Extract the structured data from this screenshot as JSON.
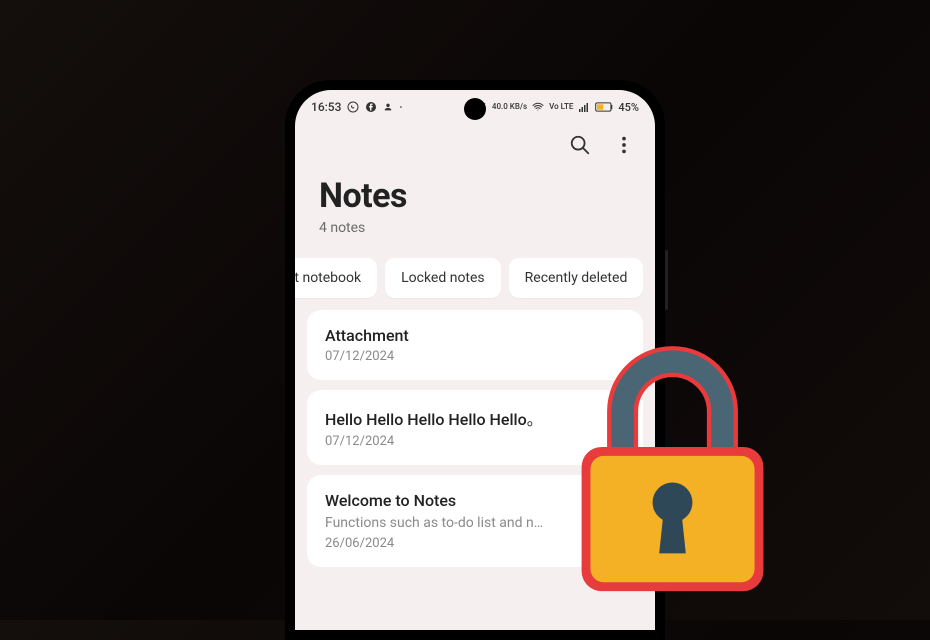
{
  "statusBar": {
    "time": "16:53",
    "dataRate": "40.0 KB/s",
    "lte": "Vo LTE",
    "battery": "45%"
  },
  "header": {
    "title": "Notes",
    "subtitle": "4 notes"
  },
  "chips": [
    {
      "label": "lt notebook"
    },
    {
      "label": "Locked notes"
    },
    {
      "label": "Recently deleted"
    }
  ],
  "notes": [
    {
      "title": "Attachment",
      "subtitle": "",
      "date": "07/12/2024"
    },
    {
      "title": "Hello Hello Hello Hello Hello。",
      "subtitle": "",
      "date": "07/12/2024"
    },
    {
      "title": "Welcome to Notes",
      "subtitle": "Functions such as to-do list and n…",
      "date": "26/06/2024"
    }
  ]
}
